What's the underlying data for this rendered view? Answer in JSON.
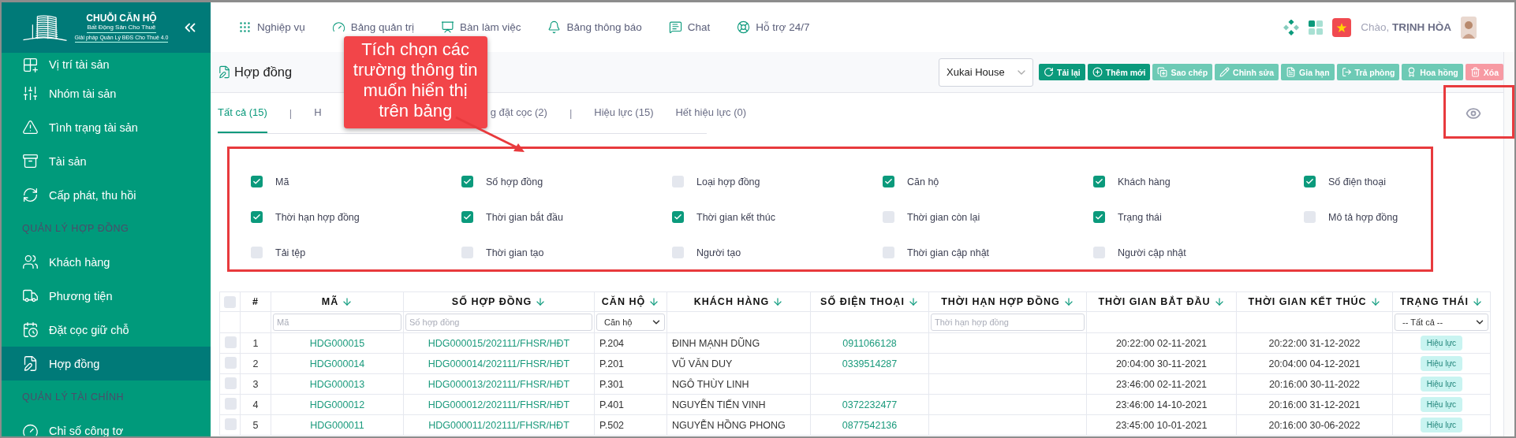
{
  "sidebar": {
    "logo": {
      "title": "CHUỖI CĂN HỘ",
      "subtitle": "Bất Động Sản Cho Thuê",
      "tagline": "Giải pháp Quản Lý BĐS Cho Thuê 4.0"
    },
    "items": [
      {
        "kind": "item",
        "label": "Vị trí tài sản",
        "selected": false
      },
      {
        "kind": "item",
        "label": "Nhóm tài sản",
        "selected": false
      },
      {
        "kind": "item",
        "label": "Tình trạng tài sản",
        "selected": false
      },
      {
        "kind": "item",
        "label": "Tài sản",
        "selected": false
      },
      {
        "kind": "item",
        "label": "Cấp phát, thu hồi",
        "selected": false
      },
      {
        "kind": "section",
        "label": "QUẢN LÝ HỢP ĐỒNG"
      },
      {
        "kind": "item",
        "label": "Khách hàng",
        "selected": false
      },
      {
        "kind": "item",
        "label": "Phương tiện",
        "selected": false
      },
      {
        "kind": "item",
        "label": "Đặt cọc giữ chỗ",
        "selected": false
      },
      {
        "kind": "item",
        "label": "Hợp đồng",
        "selected": true
      },
      {
        "kind": "section",
        "label": "QUẢN LÝ TÀI CHÍNH"
      },
      {
        "kind": "item",
        "label": "Chỉ số công tơ",
        "selected": false
      }
    ]
  },
  "top_nav": {
    "items": [
      {
        "label": "Nghiệp vụ"
      },
      {
        "label": "Bảng quản trị"
      },
      {
        "label": "Bàn làm việc"
      },
      {
        "label": "Bảng thông báo"
      },
      {
        "label": "Chat"
      },
      {
        "label": "Hỗ trợ 24/7"
      }
    ],
    "greeting": "Chào, **TRỊNH HÒA**"
  },
  "page": {
    "title": "Hợp đồng",
    "house_select": {
      "value": "Xukai House"
    },
    "buttons": [
      {
        "label": "Tải lại",
        "kind": "primary",
        "disabled": false
      },
      {
        "label": "Thêm mới",
        "kind": "primary",
        "disabled": false
      },
      {
        "label": "Sao chép",
        "kind": "primary",
        "disabled": true
      },
      {
        "label": "Chỉnh sửa",
        "kind": "primary",
        "disabled": true
      },
      {
        "label": "Gia hạn",
        "kind": "primary",
        "disabled": true
      },
      {
        "label": "Trả phòng",
        "kind": "primary",
        "disabled": true
      },
      {
        "label": "Hoa hồng",
        "kind": "primary",
        "disabled": true
      },
      {
        "label": "Xóa",
        "kind": "danger",
        "disabled": true
      }
    ]
  },
  "tabs": [
    {
      "kind": "tab",
      "label": "Tất cả (15)",
      "selected": true
    },
    {
      "kind": "separator",
      "label": "|"
    },
    {
      "kind": "tab",
      "label": "H",
      "selected": false
    },
    {
      "kind": "tab",
      "label": "g đặt cọc (2)",
      "selected": false
    },
    {
      "kind": "separator",
      "label": "|"
    },
    {
      "kind": "tab",
      "label": "Hiệu lực (15)",
      "selected": false
    },
    {
      "kind": "tab",
      "label": "Hết hiệu lực (0)",
      "selected": false
    }
  ],
  "callout": {
    "text": "Tích chọn các trường thông tin muốn hiển thị trên bảng"
  },
  "column_picker": {
    "fields": [
      {
        "label": "Mã",
        "checked": true
      },
      {
        "label": "Số hợp đồng",
        "checked": true
      },
      {
        "label": "Loại hợp đồng",
        "checked": false
      },
      {
        "label": "Căn hộ",
        "checked": true
      },
      {
        "label": "Khách hàng",
        "checked": true
      },
      {
        "label": "Số điện thoại",
        "checked": true
      },
      {
        "label": "Thời hạn hợp đồng",
        "checked": true
      },
      {
        "label": "Thời gian bắt đầu",
        "checked": true
      },
      {
        "label": "Thời gian kết thúc",
        "checked": true
      },
      {
        "label": "Thời gian còn lại",
        "checked": false
      },
      {
        "label": "Trạng thái",
        "checked": true
      },
      {
        "label": "Mô tả hợp đồng",
        "checked": false
      },
      {
        "label": "Tải tệp",
        "checked": false
      },
      {
        "label": "Thời gian tạo",
        "checked": false
      },
      {
        "label": "Người tạo",
        "checked": false
      },
      {
        "label": "Thời gian cập nhật",
        "checked": false
      },
      {
        "label": "Người cập nhật",
        "checked": false
      }
    ]
  },
  "table": {
    "select_all": {
      "checked": false
    },
    "columns": [
      {
        "header": "#",
        "kind": "index",
        "sortable": false
      },
      {
        "header": "MÃ",
        "kind": "link",
        "sortable": true,
        "filter": {
          "kind": "input",
          "placeholder": "Mã"
        }
      },
      {
        "header": "SỐ HỢP ĐỒNG",
        "kind": "link",
        "sortable": true,
        "filter": {
          "kind": "input",
          "placeholder": "Số hợp đồng"
        }
      },
      {
        "header": "CĂN HỘ",
        "kind": "text",
        "sortable": true,
        "filter": {
          "kind": "select",
          "value": "Căn hộ"
        }
      },
      {
        "header": "KHÁCH HÀNG",
        "kind": "text",
        "sortable": true
      },
      {
        "header": "SỐ ĐIỆN THOẠI",
        "kind": "link",
        "sortable": true
      },
      {
        "header": "THỜI HẠN HỢP ĐỒNG",
        "kind": "text",
        "sortable": true,
        "filter": {
          "kind": "input",
          "placeholder": "Thời hạn hợp đồng"
        }
      },
      {
        "header": "THỜI GIAN BẮT ĐẦU",
        "kind": "time",
        "sortable": true
      },
      {
        "header": "THỜI GIAN KẾT THÚC",
        "kind": "time",
        "sortable": true
      },
      {
        "header": "TRẠNG THÁI",
        "kind": "status",
        "sortable": true,
        "filter": {
          "kind": "select",
          "value": "-- Tất cả --"
        }
      }
    ],
    "rows": [
      {
        "selected": false,
        "cells": [
          "1",
          "HDG000015",
          "HDG000015/202111/FHSR/HĐT",
          "P.204",
          "ĐINH MẠNH DŨNG",
          "0911066128",
          null,
          "20:22:00 02-11-2021",
          "20:22:00 31-12-2022",
          "Hiệu lực"
        ]
      },
      {
        "selected": false,
        "cells": [
          "2",
          "HDG000014",
          "HDG000014/202111/FHSR/HĐT",
          "P.201",
          "VŨ VĂN DUY",
          "0339514287",
          null,
          "20:04:00 30-11-2021",
          "20:04:00 04-12-2021",
          "Hiệu lực"
        ]
      },
      {
        "selected": false,
        "cells": [
          "3",
          "HDG000013",
          "HDG000013/202111/FHSR/HĐT",
          "P.301",
          "NGÔ THÙY LINH",
          null,
          null,
          "23:46:00 02-11-2021",
          "20:16:00 30-11-2022",
          "Hiệu lực"
        ]
      },
      {
        "selected": false,
        "cells": [
          "4",
          "HDG000012",
          "HDG000012/202111/FHSR/HĐT",
          "P.401",
          "NGUYỄN TIẾN VINH",
          "0372232477",
          null,
          "23:46:00 14-10-2021",
          "20:16:00 31-12-2021",
          "Hiệu lực"
        ]
      },
      {
        "selected": false,
        "cells": [
          "5",
          "HDG000011",
          "HDG000011/202111/FHSR/HĐT",
          "P.502",
          "NGUYỄN HỒNG PHONG",
          "0877542136",
          null,
          "23:45:00 10-01-2021",
          "20:16:00 30-06-2022",
          "Hiệu lực"
        ]
      }
    ]
  }
}
